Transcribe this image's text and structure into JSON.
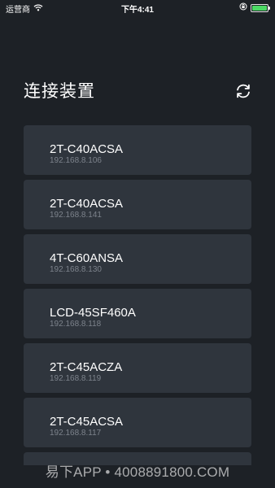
{
  "status_bar": {
    "carrier": "运营商",
    "time": "下午4:41"
  },
  "header": {
    "title": "连接装置"
  },
  "devices": [
    {
      "name": "2T-C40ACSA",
      "ip": "192.168.8.106"
    },
    {
      "name": "2T-C40ACSA",
      "ip": "192.168.8.141"
    },
    {
      "name": "4T-C60ANSA",
      "ip": "192.168.8.130"
    },
    {
      "name": "LCD-45SF460A",
      "ip": "192.168.8.118"
    },
    {
      "name": "2T-C45ACZA",
      "ip": "192.168.8.119"
    },
    {
      "name": "2T-C45ACSA",
      "ip": "192.168.8.117"
    },
    {
      "name": "",
      "ip": ""
    }
  ],
  "watermark": "易下APP • 4008891800.COM",
  "colors": {
    "background": "#1d2126",
    "card": "#2f353d",
    "ip_text": "#7d838c",
    "battery": "#4cd964"
  }
}
